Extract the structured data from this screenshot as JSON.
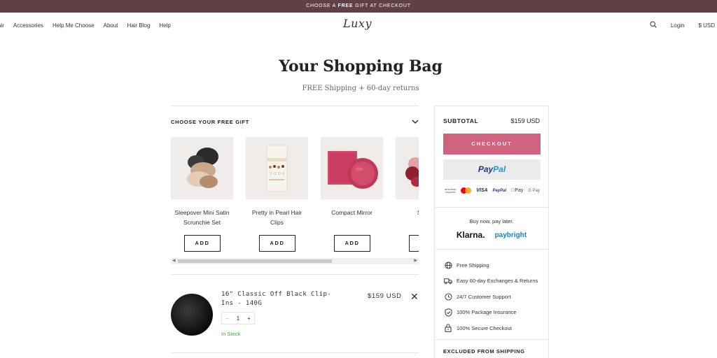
{
  "promo": {
    "prefix": "CHOOSE A ",
    "highlight": "FREE",
    "suffix": " GIFT AT CHECKOUT"
  },
  "nav": {
    "links": [
      "air",
      "Accessories",
      "Help Me Choose",
      "About",
      "Hair Blog",
      "Help"
    ],
    "logo": "Luxy",
    "login": "Login",
    "currency": "$ USD"
  },
  "page": {
    "title": "Your Shopping Bag",
    "subtitle": "FREE Shipping + 60-day returns"
  },
  "gift": {
    "header": "CHOOSE YOUR FREE GIFT",
    "add_label": "ADD",
    "items": [
      {
        "name": "Sleepover Mini Satin Scrunchie Set",
        "image": "scrunchie-set"
      },
      {
        "name": "Pretty in Pearl Hair Clips",
        "image": "pearl-clips"
      },
      {
        "name": "Compact Mirror",
        "image": "compact-mirror"
      },
      {
        "name": "Satin S",
        "image": "satin-scrunchie"
      }
    ]
  },
  "cart": {
    "item": {
      "name": "16\" Classic Off Black Clip-Ins - 140G",
      "price": "$159 USD",
      "quantity": "1",
      "stock": "In Stock",
      "remove_symbol": "✕"
    }
  },
  "summary": {
    "subtotal_label": "SUBTOTAL",
    "subtotal_value": "$159 USD",
    "checkout_label": "CHECKOUT",
    "paypal": {
      "part1": "Pay",
      "part2": "Pal"
    },
    "payment_icons": [
      "american-express",
      "mastercard",
      "VISA",
      "PayPal",
      "Pay",
      "G Pay"
    ],
    "bnpl_title": "Buy now, pay later.",
    "klarna": "Klarna.",
    "paybright": "paybright",
    "features": [
      {
        "icon": "globe-icon",
        "label": "Free Shipping"
      },
      {
        "icon": "truck-icon",
        "label": "Easy 60-day Exchanges & Returns"
      },
      {
        "icon": "clock-icon",
        "label": "24/7 Customer Support"
      },
      {
        "icon": "shield-check-icon",
        "label": "100% Package Insurance"
      },
      {
        "icon": "lock-icon",
        "label": "100% Secure Checkout"
      }
    ],
    "excluded_label": "EXCLUDED FROM SHIPPING"
  },
  "colors": {
    "promo_bg": "#5e4046",
    "checkout": "#d0637d",
    "in_stock": "#47a447"
  }
}
